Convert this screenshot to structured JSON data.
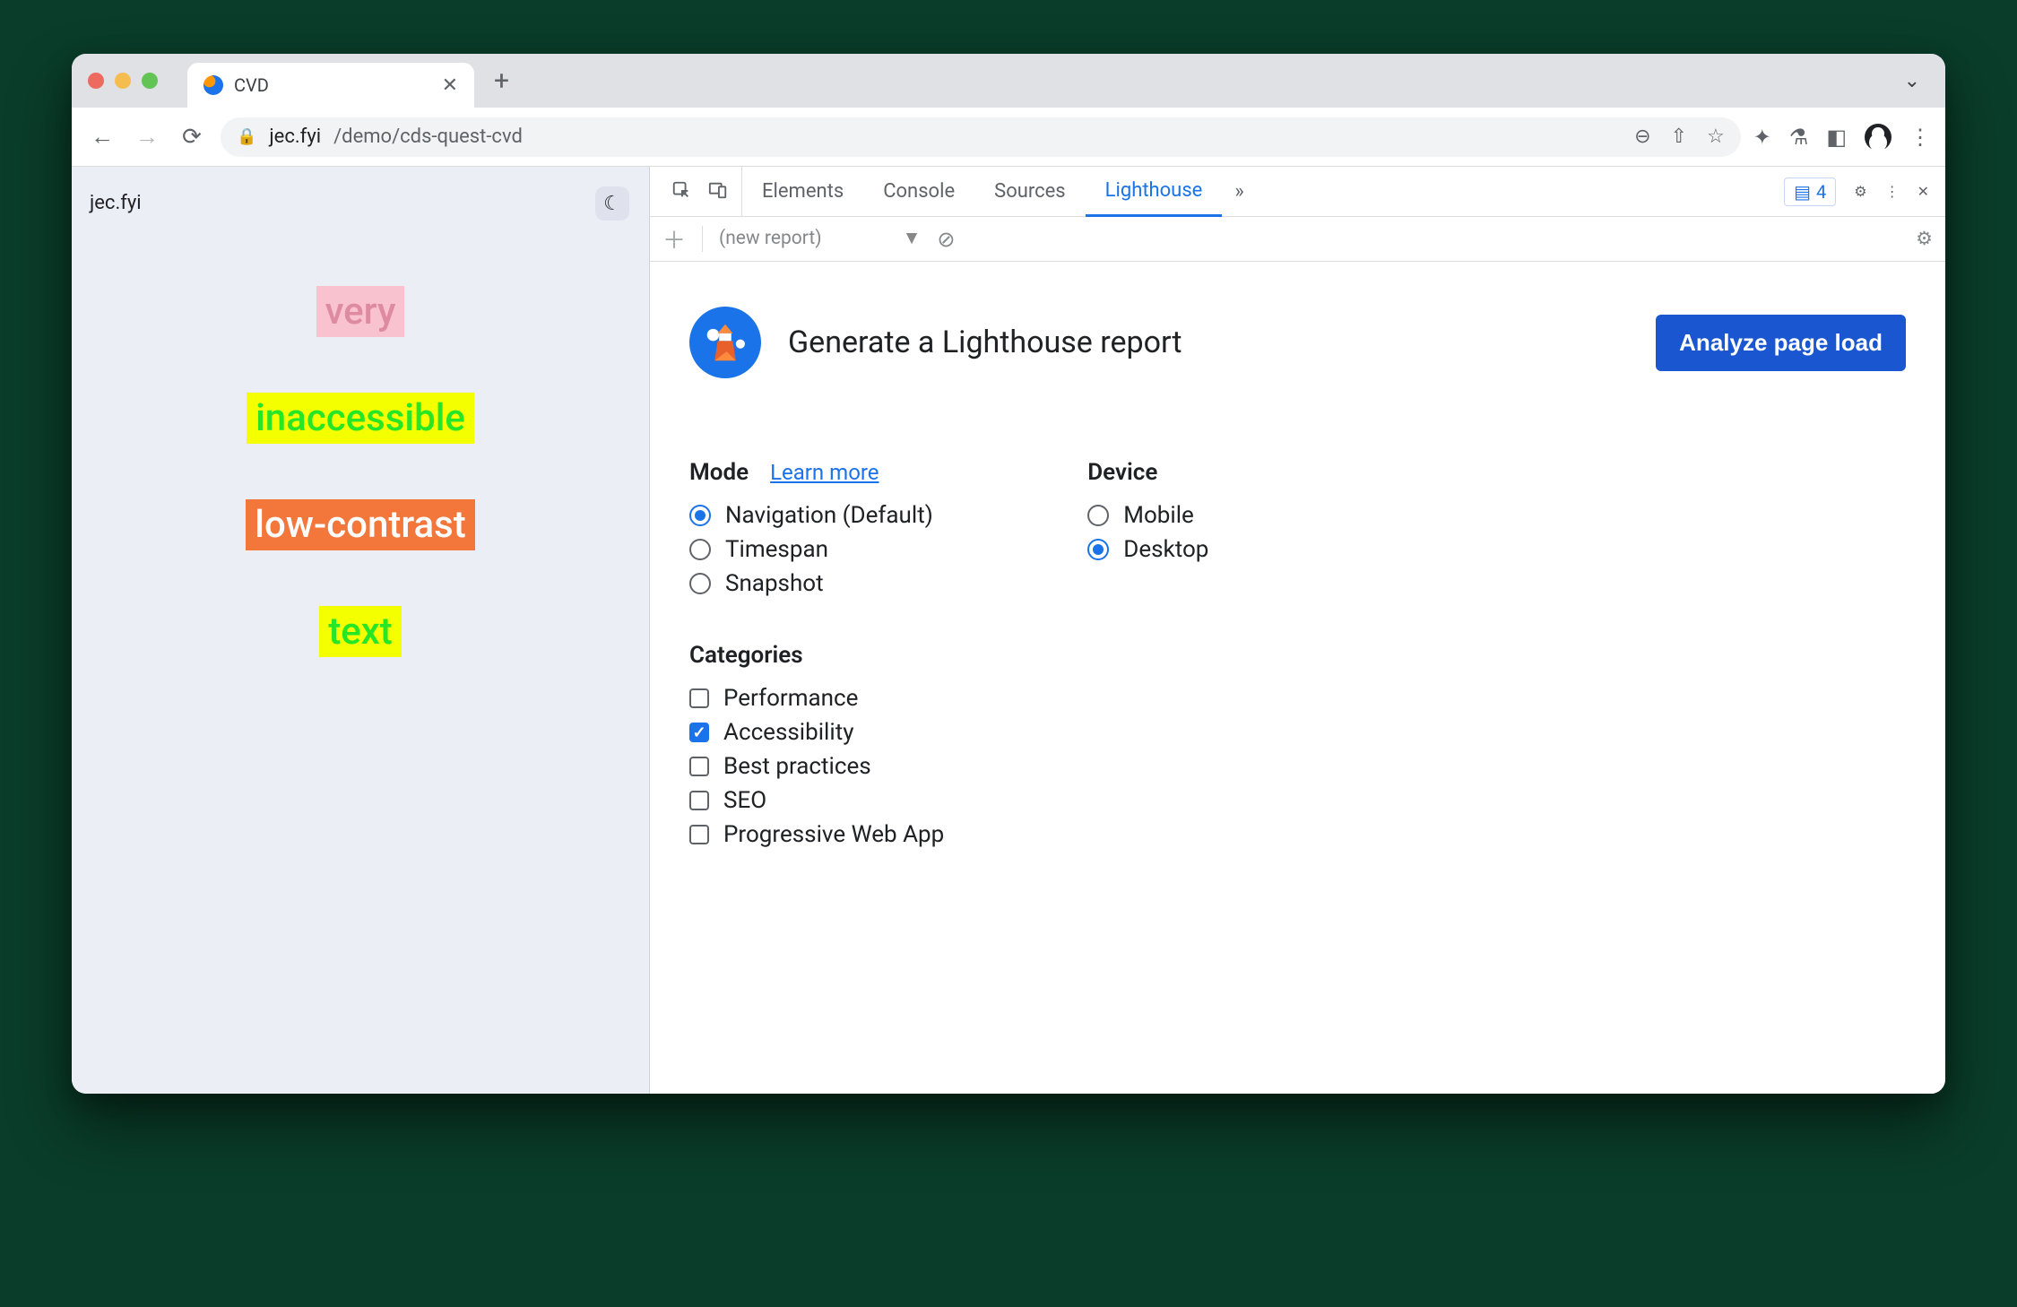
{
  "tab": {
    "title": "CVD"
  },
  "url": {
    "host": "jec.fyi",
    "path": "/demo/cds-quest-cvd"
  },
  "page": {
    "brand": "jec.fyi",
    "words": [
      "very",
      "inaccessible",
      "low-contrast",
      "text"
    ]
  },
  "devtools": {
    "tabs": [
      "Elements",
      "Console",
      "Sources",
      "Lighthouse"
    ],
    "active_tab": "Lighthouse",
    "issues_count": "4",
    "subbar": {
      "new_report": "(new report)"
    }
  },
  "lighthouse": {
    "heading": "Generate a Lighthouse report",
    "button": "Analyze page load",
    "mode_label": "Mode",
    "learn_more": "Learn more",
    "modes": [
      {
        "label": "Navigation (Default)",
        "checked": true
      },
      {
        "label": "Timespan",
        "checked": false
      },
      {
        "label": "Snapshot",
        "checked": false
      }
    ],
    "device_label": "Device",
    "devices": [
      {
        "label": "Mobile",
        "checked": false
      },
      {
        "label": "Desktop",
        "checked": true
      }
    ],
    "categories_label": "Categories",
    "categories": [
      {
        "label": "Performance",
        "checked": false
      },
      {
        "label": "Accessibility",
        "checked": true
      },
      {
        "label": "Best practices",
        "checked": false
      },
      {
        "label": "SEO",
        "checked": false
      },
      {
        "label": "Progressive Web App",
        "checked": false
      }
    ]
  }
}
